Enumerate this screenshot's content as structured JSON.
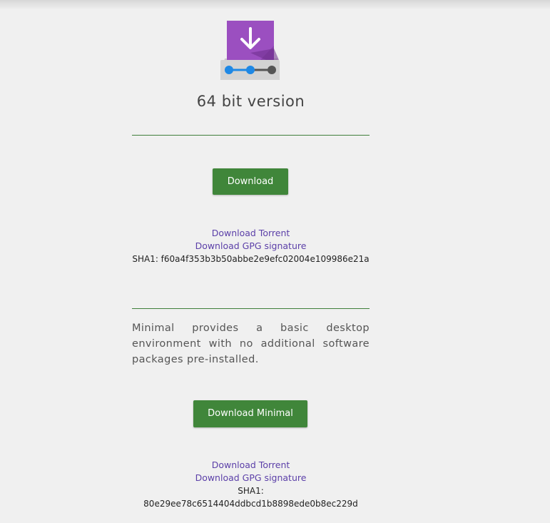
{
  "version_title": "64 bit version",
  "download_button": "Download",
  "standard": {
    "torrent_link": "Download Torrent",
    "gpg_link": "Download GPG signature",
    "sha1": "SHA1: f60a4f353b3b50abbe2e9efc02004e109986e21a"
  },
  "minimal": {
    "description": "Minimal provides a basic desktop environment with no additional software packages pre-installed.",
    "button": "Download Minimal",
    "torrent_link": "Download Torrent",
    "gpg_link": "Download GPG signature",
    "sha1_label": "SHA1:",
    "sha1_value": "80e29ee78c6514404ddbcd1b8898ede0b8ec229d"
  },
  "colors": {
    "button": "#40863a",
    "link": "#5b3fa8",
    "divider": "#3f7f3a",
    "icon_purple": "#8e44ad"
  },
  "icons": {
    "installer": "download-drive-icon"
  }
}
